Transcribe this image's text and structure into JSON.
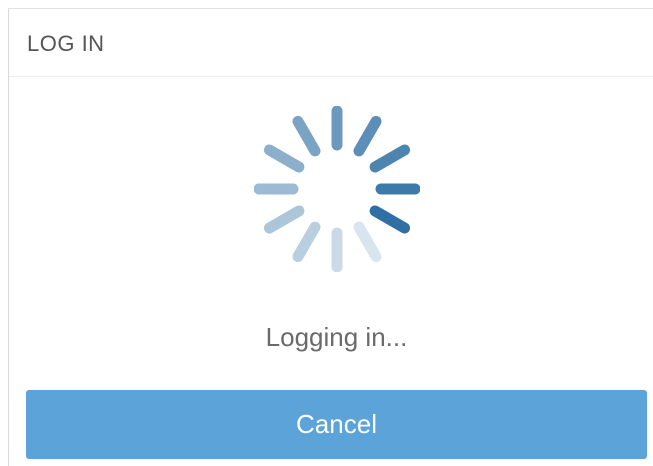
{
  "dialog": {
    "title": "LOG IN",
    "status_text": "Logging in...",
    "cancel_label": "Cancel"
  },
  "spinner": {
    "icon": "loading-spinner-icon",
    "color": "#2f6fa3",
    "segment_count": 12
  },
  "colors": {
    "accent": "#5ba3d9",
    "spinner": "#2f6fa3",
    "text": "#6a6a6a"
  }
}
